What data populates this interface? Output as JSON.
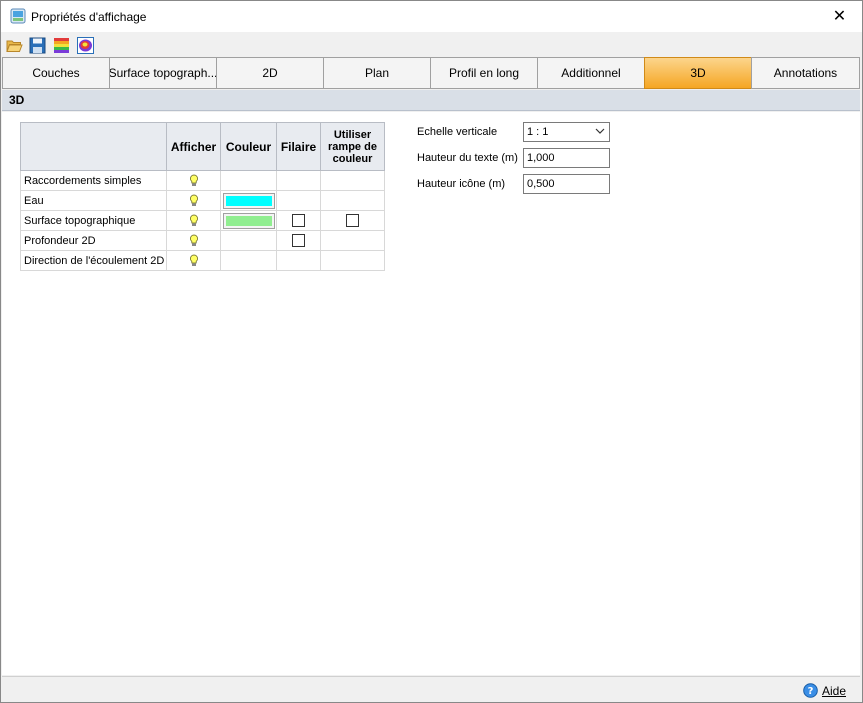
{
  "window": {
    "title": "Propriétés d'affichage",
    "close_glyph": "✕"
  },
  "toolbar": {
    "buttons": [
      {
        "icon": "folder-open-icon"
      },
      {
        "icon": "save-icon"
      },
      {
        "icon": "color-ramp-icon"
      },
      {
        "icon": "color-palette-icon"
      }
    ]
  },
  "tabs": [
    {
      "label": "Couches"
    },
    {
      "label": "Surface topograph..."
    },
    {
      "label": "2D"
    },
    {
      "label": "Plan"
    },
    {
      "label": "Profil en long"
    },
    {
      "label": "Additionnel"
    },
    {
      "label": "3D",
      "active": true
    },
    {
      "label": "Annotations"
    }
  ],
  "section": {
    "title": "3D"
  },
  "grid": {
    "headers": {
      "name": "",
      "show": "Afficher",
      "color": "Couleur",
      "wireframe": "Filaire",
      "ramp": "Utiliser rampe de couleur"
    },
    "rows": [
      {
        "label": "Raccordements simples",
        "show": true,
        "color": null,
        "wireframe": null,
        "ramp": null
      },
      {
        "label": "Eau",
        "show": true,
        "color": "#00ffff",
        "wireframe": null,
        "ramp": null
      },
      {
        "label": "Surface topographique",
        "show": true,
        "color": "#90ee90",
        "wireframe": false,
        "ramp": false
      },
      {
        "label": "Profondeur 2D",
        "show": true,
        "color": null,
        "wireframe": false,
        "ramp": null
      },
      {
        "label": "Direction de l'écoulement 2D",
        "show": true,
        "color": null,
        "wireframe": null,
        "ramp": null
      }
    ]
  },
  "properties": {
    "vertical_scale": {
      "label": "Echelle verticale",
      "value": "1 : 1"
    },
    "text_height": {
      "label": "Hauteur du texte (m)",
      "value": "1,000"
    },
    "icon_height": {
      "label": "Hauteur icône (m)",
      "value": "0,500"
    }
  },
  "footer": {
    "help_label": "Aide"
  },
  "colors": {
    "active_tab": "#f5a623",
    "section_bg": "#d9dfe7",
    "bulb": "#ffff66"
  }
}
